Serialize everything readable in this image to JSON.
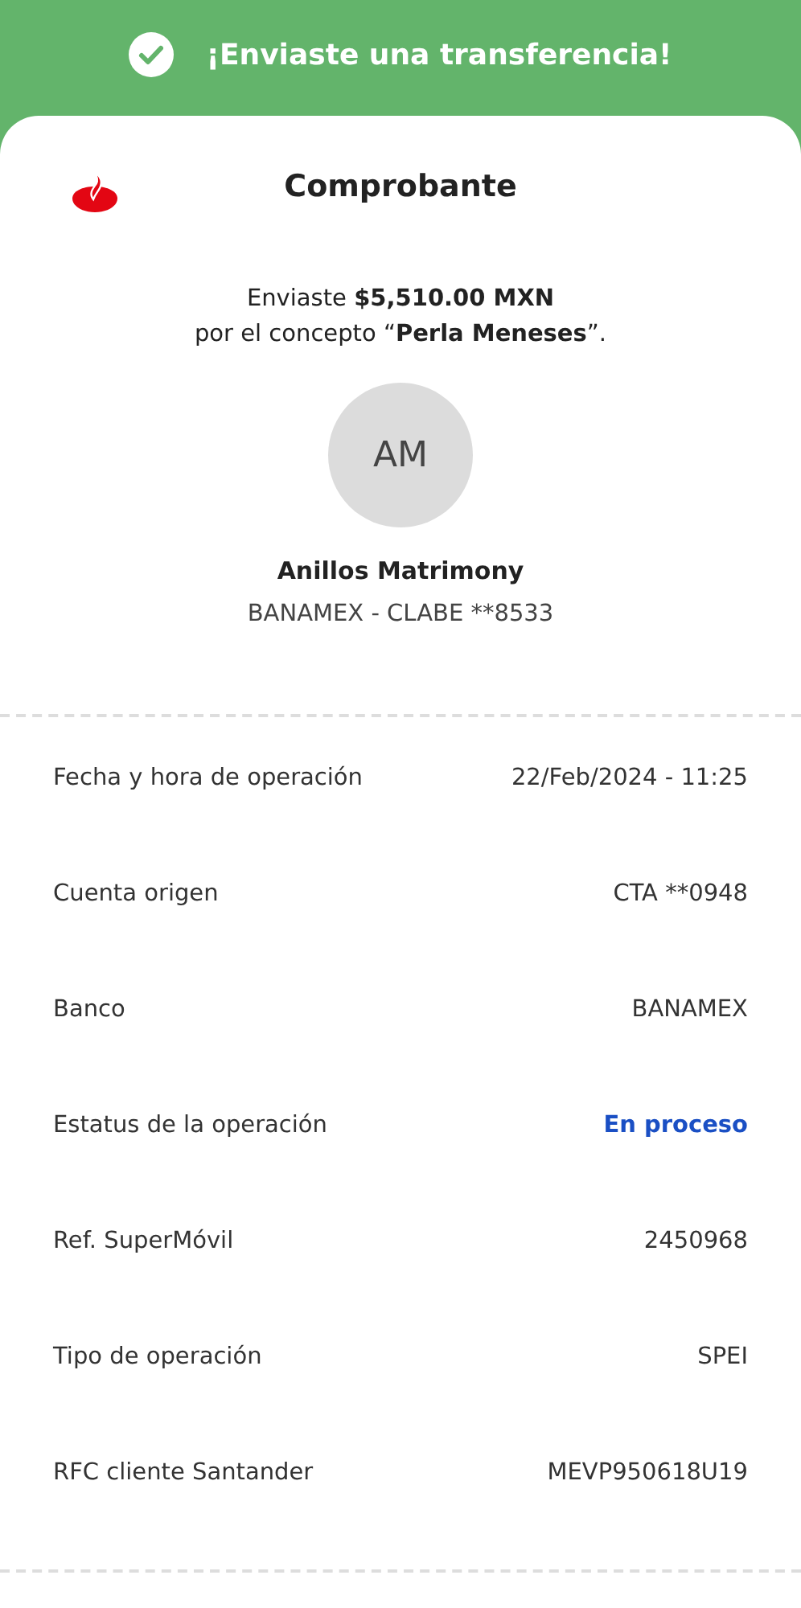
{
  "banner": {
    "title": "¡Enviaste una transferencia!"
  },
  "receipt": {
    "title": "Comprobante",
    "message_lines": [
      "Enviaste **$5,510.00 MXN**",
      "por el concepto “**Perla Meneses**”."
    ],
    "recipient": {
      "initials": "AM",
      "name": "Anillos Matrimony",
      "account": "BANAMEX - CLABE **8533"
    },
    "details": [
      {
        "label": "Fecha y hora de operación",
        "value": "22/Feb/2024 - 11:25",
        "kind": "text"
      },
      {
        "label": "Cuenta origen",
        "value": "CTA **0948",
        "kind": "text"
      },
      {
        "label": "Banco",
        "value": "BANAMEX",
        "kind": "text"
      },
      {
        "label": "Estatus de la operación",
        "value": "En proceso",
        "kind": "status"
      },
      {
        "label": "Ref. SuperMóvil",
        "value": "2450968",
        "kind": "text"
      },
      {
        "label": "Tipo de operación",
        "value": "SPEI",
        "kind": "text"
      },
      {
        "label": "RFC cliente Santander",
        "value": "MEVP950618U19",
        "kind": "text"
      }
    ]
  }
}
